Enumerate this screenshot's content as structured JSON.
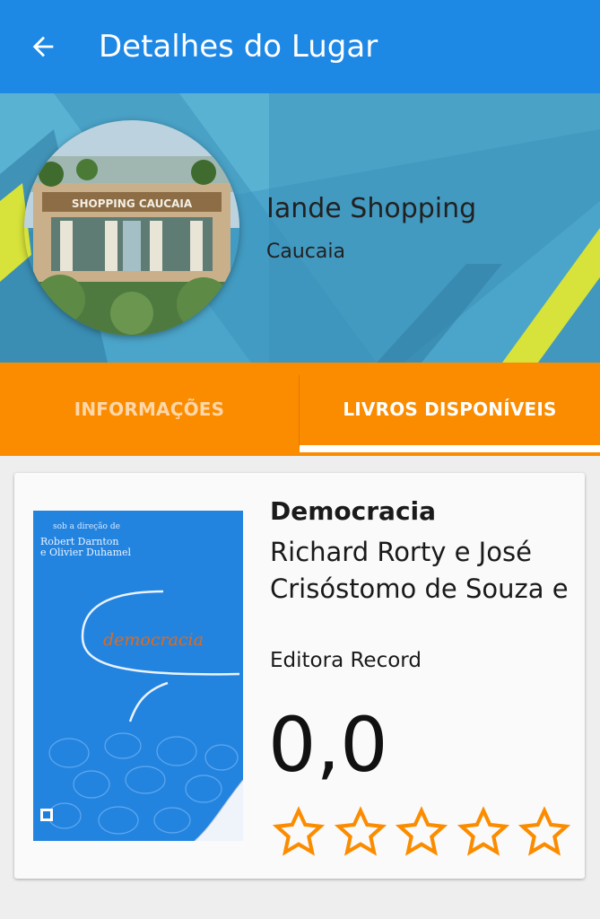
{
  "app_bar": {
    "title": "Detalhes do Lugar",
    "back_icon": "arrow-left-icon",
    "color": "#1e88e5"
  },
  "place": {
    "name": "Iande Shopping",
    "city": "Caucaia",
    "photo_sign": "SHOPPING CAUCAIA"
  },
  "tabs": [
    {
      "label": "INFORMAÇÕES",
      "selected": false
    },
    {
      "label": "LIVROS DISPONÍVEIS",
      "selected": true
    }
  ],
  "tab_color": "#fb8c00",
  "book": {
    "title": "Democracia",
    "authors": "Richard Rorty e José Crisóstomo de Souza e",
    "publisher": "Editora Record",
    "rating": "0,0",
    "stars_filled": 0,
    "stars_total": 5,
    "star_color": "#fb8c00",
    "cover": {
      "editor_line": "sob a direção de",
      "editors_1": "Robert Darnton",
      "editors_2": "e Olivier Duhamel",
      "title": "democracia"
    }
  }
}
